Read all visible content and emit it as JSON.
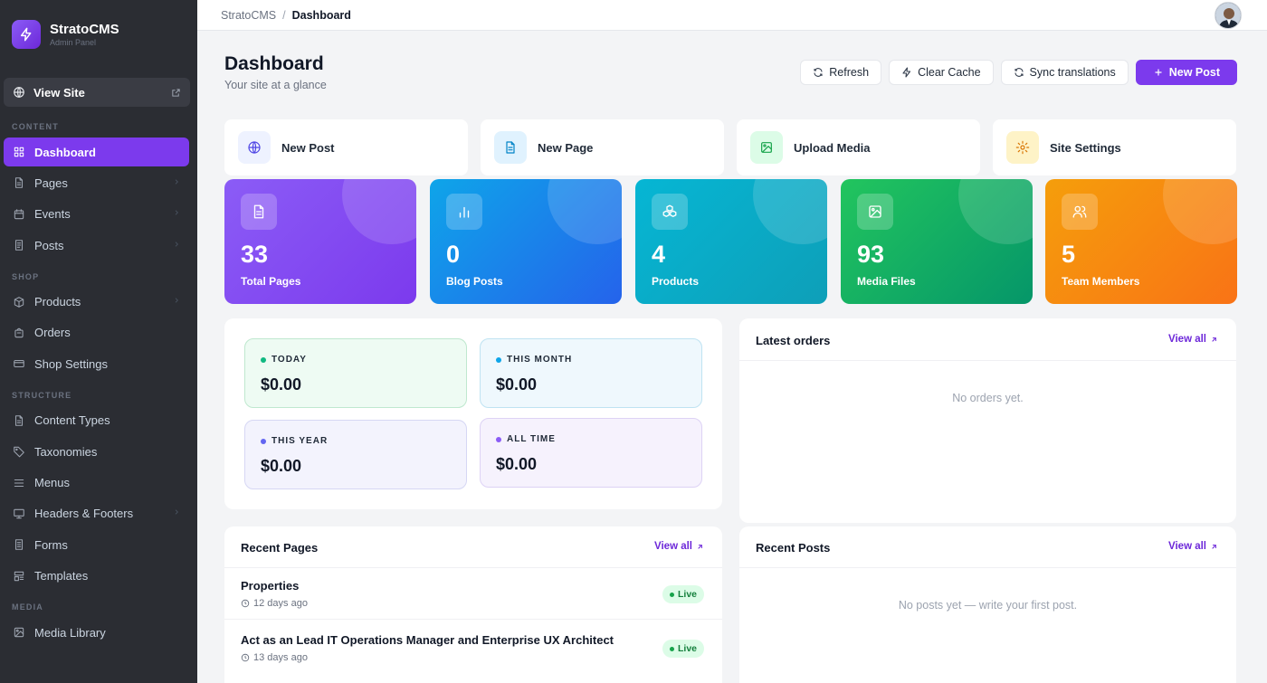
{
  "brand": {
    "name_main": "Strato",
    "name_accent": "CMS",
    "subtitle": "Admin Panel"
  },
  "sidebar": {
    "view_site": "View Site",
    "sections": [
      {
        "label": "CONTENT",
        "items": [
          {
            "label": "Dashboard",
            "icon": "grid-icon",
            "active": true,
            "chevron": false
          },
          {
            "label": "Pages",
            "icon": "file-icon",
            "chevron": true
          },
          {
            "label": "Events",
            "icon": "calendar-icon",
            "chevron": true
          },
          {
            "label": "Posts",
            "icon": "document-icon",
            "chevron": true
          }
        ]
      },
      {
        "label": "SHOP",
        "items": [
          {
            "label": "Products",
            "icon": "box-icon",
            "chevron": true
          },
          {
            "label": "Orders",
            "icon": "bag-icon",
            "chevron": false
          },
          {
            "label": "Shop Settings",
            "icon": "card-icon",
            "chevron": false
          }
        ]
      },
      {
        "label": "STRUCTURE",
        "items": [
          {
            "label": "Content Types",
            "icon": "file-icon",
            "chevron": false
          },
          {
            "label": "Taxonomies",
            "icon": "tag-icon",
            "chevron": false
          },
          {
            "label": "Menus",
            "icon": "menu-icon",
            "chevron": false
          },
          {
            "label": "Headers & Footers",
            "icon": "monitor-icon",
            "chevron": true
          },
          {
            "label": "Forms",
            "icon": "form-icon",
            "chevron": false
          },
          {
            "label": "Templates",
            "icon": "template-icon",
            "chevron": false
          }
        ]
      },
      {
        "label": "MEDIA",
        "items": [
          {
            "label": "Media Library",
            "icon": "image-icon",
            "chevron": false
          }
        ]
      }
    ]
  },
  "topbar": {
    "crumb_root": "StratoCMS",
    "crumb_sep": "/",
    "crumb_current": "Dashboard"
  },
  "header": {
    "title": "Dashboard",
    "subtitle": "Your site at a glance"
  },
  "actions": {
    "refresh": "Refresh",
    "clear_cache": "Clear Cache",
    "sync": "Sync translations",
    "new_post": "New Post"
  },
  "quick_actions": [
    {
      "label": "New Post",
      "icon": "globe-icon",
      "bg": "#eef2ff",
      "color": "#4f46e5"
    },
    {
      "label": "New Page",
      "icon": "file-icon",
      "bg": "#e0f2fe",
      "color": "#0284c7"
    },
    {
      "label": "Upload Media",
      "icon": "image-icon",
      "bg": "#dcfce7",
      "color": "#16a34a"
    },
    {
      "label": "Site Settings",
      "icon": "gear-icon",
      "bg": "#fef3c7",
      "color": "#d97706"
    }
  ],
  "stats": [
    {
      "value": "33",
      "label": "Total Pages",
      "icon": "file-icon",
      "gradient": [
        "#8b5cf6",
        "#7c3aed"
      ]
    },
    {
      "value": "0",
      "label": "Blog Posts",
      "icon": "bar-chart-icon",
      "gradient": [
        "#0ea5e9",
        "#2563eb"
      ]
    },
    {
      "value": "4",
      "label": "Products",
      "icon": "boxes-icon",
      "gradient": [
        "#06b6d4",
        "#0e9fb8"
      ]
    },
    {
      "value": "93",
      "label": "Media Files",
      "icon": "image-icon",
      "gradient": [
        "#22c55e",
        "#059669"
      ]
    },
    {
      "value": "5",
      "label": "Team Members",
      "icon": "users-icon",
      "gradient": [
        "#f59e0b",
        "#f97316"
      ]
    }
  ],
  "revenue": [
    {
      "label": "TODAY",
      "value": "$0.00",
      "dot": "#10b981",
      "bg": "#eefbf3",
      "border": "#bfe8cf"
    },
    {
      "label": "THIS MONTH",
      "value": "$0.00",
      "dot": "#0ea5e9",
      "bg": "#eff8fd",
      "border": "#bfe3f2"
    },
    {
      "label": "THIS YEAR",
      "value": "$0.00",
      "dot": "#6366f1",
      "bg": "#f3f3fd",
      "border": "#d6d7f4"
    },
    {
      "label": "ALL TIME",
      "value": "$0.00",
      "dot": "#8b5cf6",
      "bg": "#f6f2fd",
      "border": "#ddd2f5"
    }
  ],
  "latest_orders": {
    "title": "Latest orders",
    "view_all": "View all",
    "empty": "No orders yet."
  },
  "recent_pages": {
    "title": "Recent Pages",
    "view_all": "View all",
    "rows": [
      {
        "title": "Properties",
        "meta": "12 days ago",
        "badge": "Live"
      },
      {
        "title": "Act as an Lead IT Operations Manager and Enterprise UX Architect",
        "meta": "13 days ago",
        "badge": "Live"
      }
    ]
  },
  "recent_posts": {
    "title": "Recent Posts",
    "view_all": "View all",
    "empty": "No posts yet — write your first post."
  }
}
